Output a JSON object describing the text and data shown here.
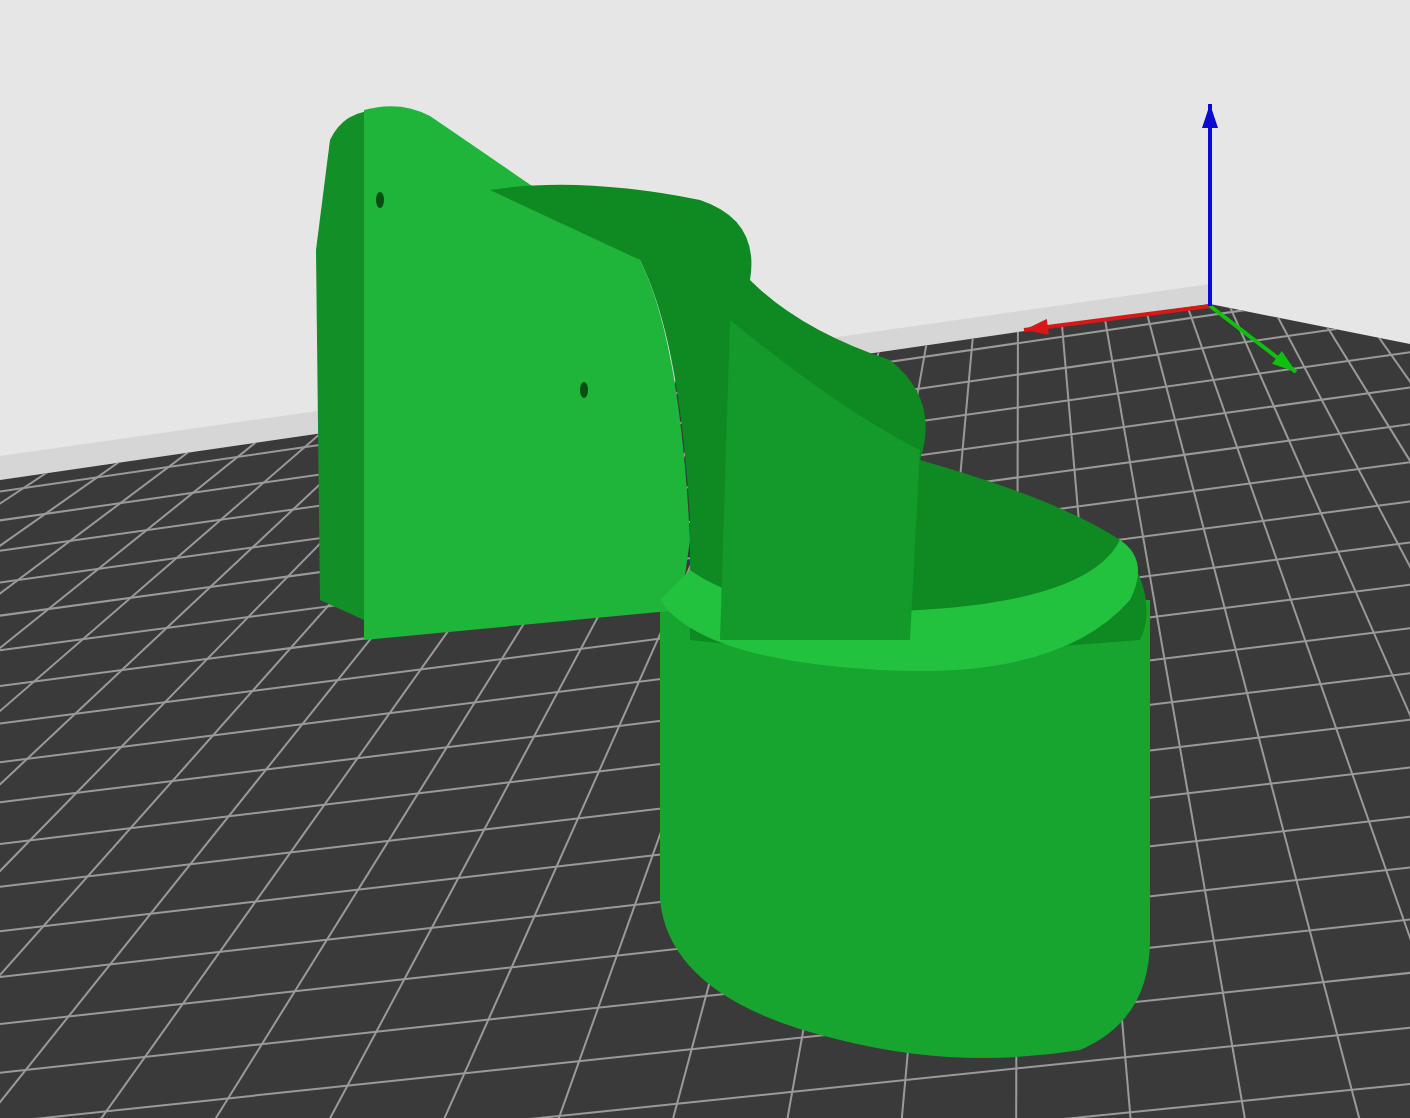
{
  "viewport": {
    "kind": "perspective"
  },
  "axes": [
    {
      "color": "#d81818"
    },
    {
      "color": "#10c010"
    },
    {
      "color": "#0a0ad0"
    }
  ]
}
